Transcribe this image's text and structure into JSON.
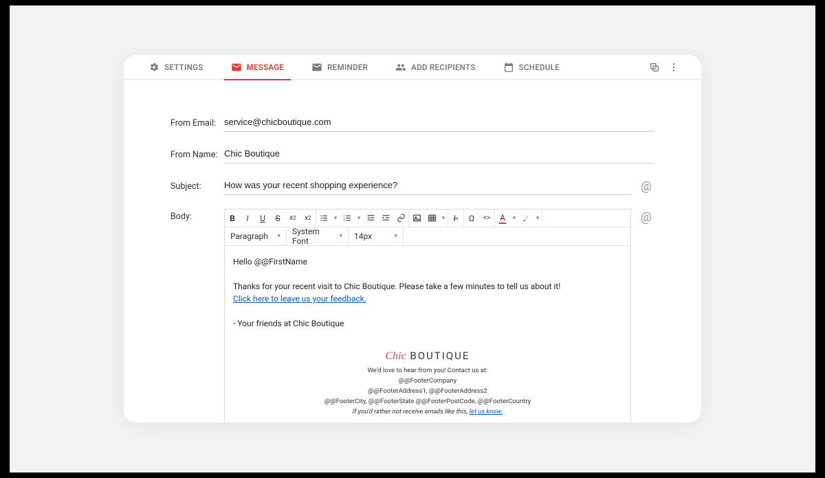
{
  "tabs": {
    "settings": "SETTINGS",
    "message": "MESSAGE",
    "reminder": "REMINDER",
    "add_recipients": "ADD RECIPIENTS",
    "schedule": "SCHEDULE"
  },
  "form": {
    "from_email_label": "From Email:",
    "from_email_value": "service@chicboutique.com",
    "from_name_label": "From Name:",
    "from_name_value": "Chic Boutique",
    "subject_label": "Subject:",
    "subject_value": "How was your recent shopping experience?",
    "body_label": "Body:"
  },
  "editor": {
    "paragraph": "Paragraph",
    "font": "System Font",
    "size": "14px"
  },
  "body": {
    "greeting": "Hello @@FirstName",
    "line1": "Thanks for your recent visit to Chic Boutique. Please take a few minutes to tell us about it!",
    "link": "Click here to leave us your feedback.",
    "signoff": "- Your friends at Chic Boutique"
  },
  "footer": {
    "brand_chic": "Chic",
    "brand_rest": " BOUTIQUE",
    "contact": "We'd love to hear from you! Contact us at:",
    "company": "@@FooterCompany",
    "address": "@@FooterAddress1, @@FooterAddress2",
    "city": "@@FooterCity, @@FooterState @@FooterPostCode, @@FooterCountry",
    "unsub_pre": "If you'd rather not receive emails like this, ",
    "unsub_link": "let us know."
  }
}
